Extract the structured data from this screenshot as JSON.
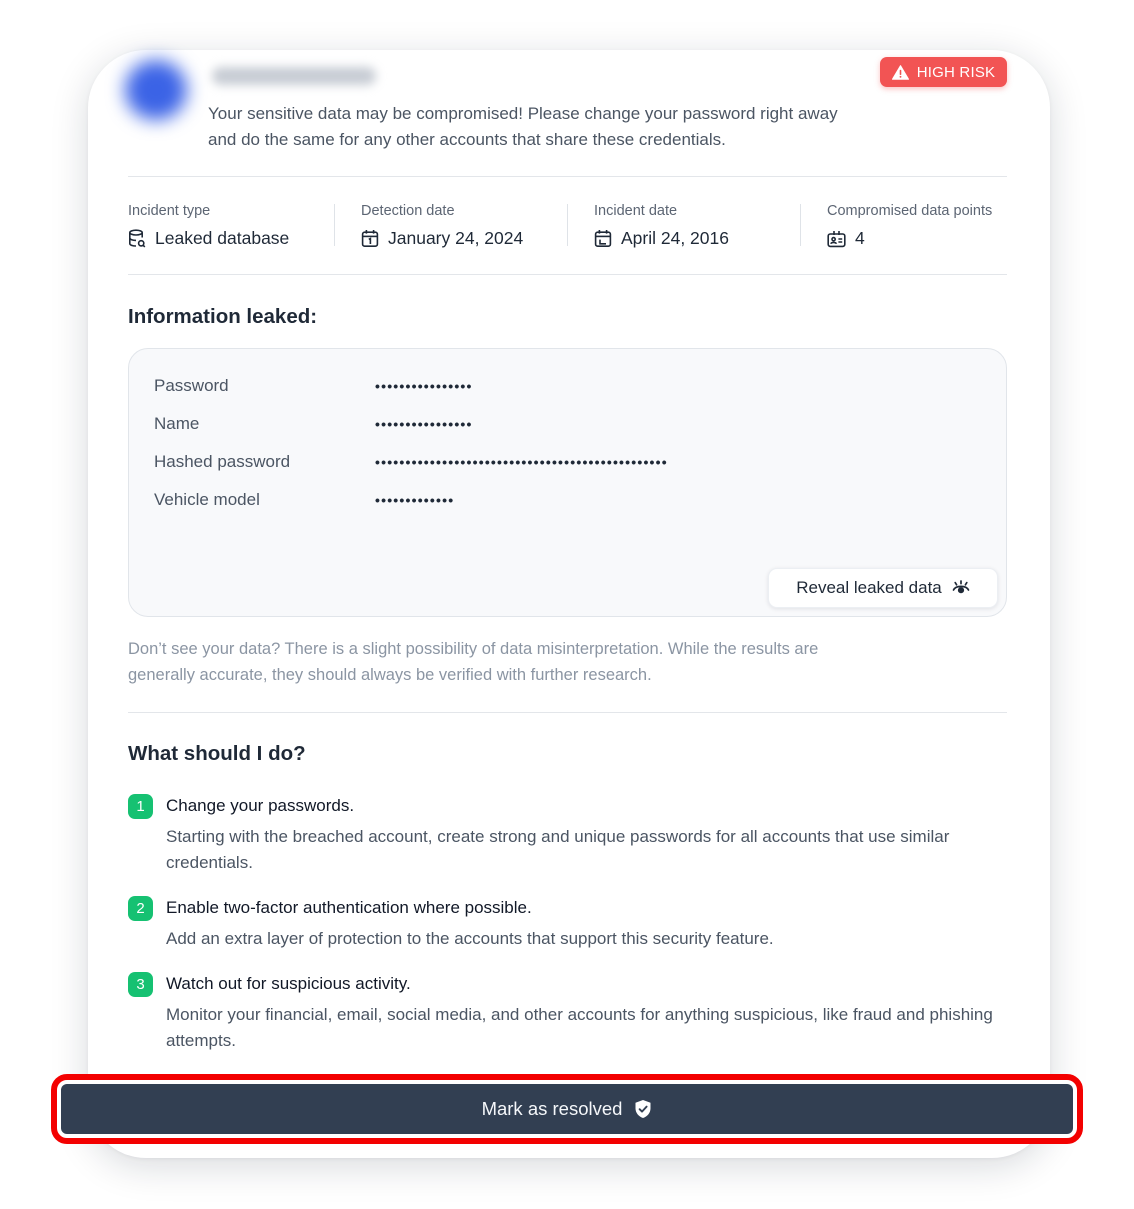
{
  "header": {
    "risk_badge": "HIGH RISK",
    "warning": "Your sensitive data may be compromised! Please change your password right away and do the same for any other accounts that share these credentials."
  },
  "stats": [
    {
      "label": "Incident type",
      "value": "Leaked database",
      "icon": "database-icon"
    },
    {
      "label": "Detection date",
      "value": "January 24, 2024",
      "icon": "calendar-icon"
    },
    {
      "label": "Incident date",
      "value": "April 24, 2016",
      "icon": "calendar-clock-icon"
    },
    {
      "label": "Compromised data points",
      "value": "4",
      "icon": "id-card-icon"
    }
  ],
  "leaked": {
    "title": "Information leaked:",
    "rows": [
      {
        "name": "Password",
        "value": "••••••••••••••••"
      },
      {
        "name": "Name",
        "value": "••••••••••••••••"
      },
      {
        "name": "Hashed password",
        "value": "••••••••••••••••••••••••••••••••••••••••••••••••"
      },
      {
        "name": "Vehicle model",
        "value": "•••••••••••••"
      }
    ],
    "reveal_label": "Reveal leaked data"
  },
  "disclaimer": "Don’t see your data? There is a slight possibility of data misinterpretation. While the results are generally accurate, they should always be verified with further research.",
  "actions": {
    "title": "What should I do?",
    "steps": [
      {
        "num": "1",
        "title": "Change your passwords.",
        "desc": "Starting with the breached account, create strong and unique passwords for all accounts that use similar credentials."
      },
      {
        "num": "2",
        "title": "Enable two-factor authentication where possible.",
        "desc": "Add an extra layer of protection to the accounts that support this security feature."
      },
      {
        "num": "3",
        "title": "Watch out for suspicious activity.",
        "desc": "Monitor your financial, email, social media, and other accounts for anything suspicious, like fraud and phishing attempts."
      }
    ]
  },
  "resolve_label": "Mark as resolved",
  "colors": {
    "danger": "#f25454",
    "success": "#16c172",
    "primary_dark": "#323f52",
    "highlight": "#f30000"
  }
}
